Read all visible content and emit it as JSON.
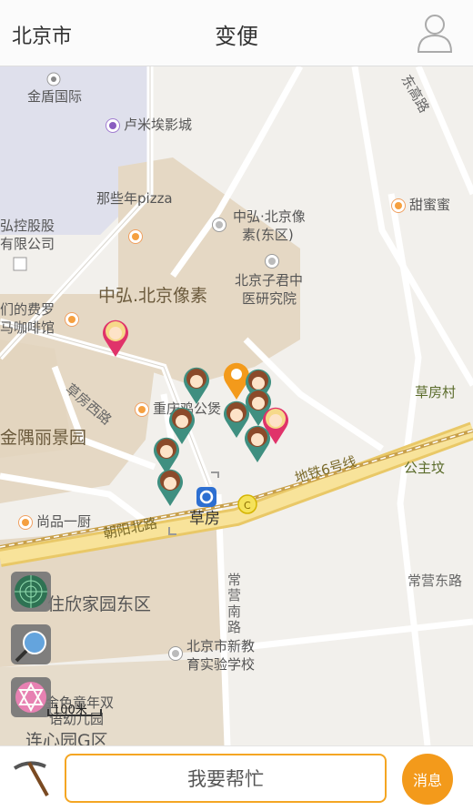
{
  "header": {
    "city": "北京市",
    "title": "变便",
    "user_icon": "user-icon"
  },
  "map": {
    "labels": {
      "jindun": "金盾国际",
      "lumiere": "卢米埃影城",
      "pizza": "那些年pizza",
      "holding": "弘控股股",
      "company": "有限公司",
      "zhonghong_small1": "中弘·北京像",
      "zhonghong_small2": "素(东区)",
      "zijun1": "北京子君中",
      "zijun2": "医研究院",
      "zhonghong_big": "中弘.北京像素",
      "feiluo1": "们的费罗",
      "feiluo2": "马咖啡馆",
      "tianmi": "甜蜜蜜",
      "caofangcun": "草房村",
      "caofangxilu": "草房西路",
      "chongqing": "重庆鸡公煲",
      "jinyu": "金隅丽景园",
      "gongzhufen": "公主坟",
      "subway6": "地铁6号线",
      "shangpin": "尚品一厨",
      "chaoyangbeilu": "朝阳北路",
      "caofang": "草房",
      "changyingnanlu": "常营南路",
      "changyingdonglu": "常营东路",
      "dongjielu": "东高路",
      "zhuxin": "住欣家园东区",
      "xinjiaoyu1": "北京市新教",
      "xinjiaoyu2": "育实验学校",
      "tongnian1": "金色童年双",
      "tongnian2": "语幼儿园",
      "lianxin": "连心园G区"
    },
    "scale": "100米",
    "tools": [
      "radar-icon",
      "search-map-icon",
      "star-badge-icon"
    ]
  },
  "footer": {
    "tool_icon": "pickaxe-icon",
    "help_label": "我要帮忙",
    "message_label": "消息"
  },
  "colors": {
    "accent": "#f39a1b",
    "border_accent": "#f4a623",
    "road_major": "#f5d27a",
    "block": "#e5d8c4"
  }
}
